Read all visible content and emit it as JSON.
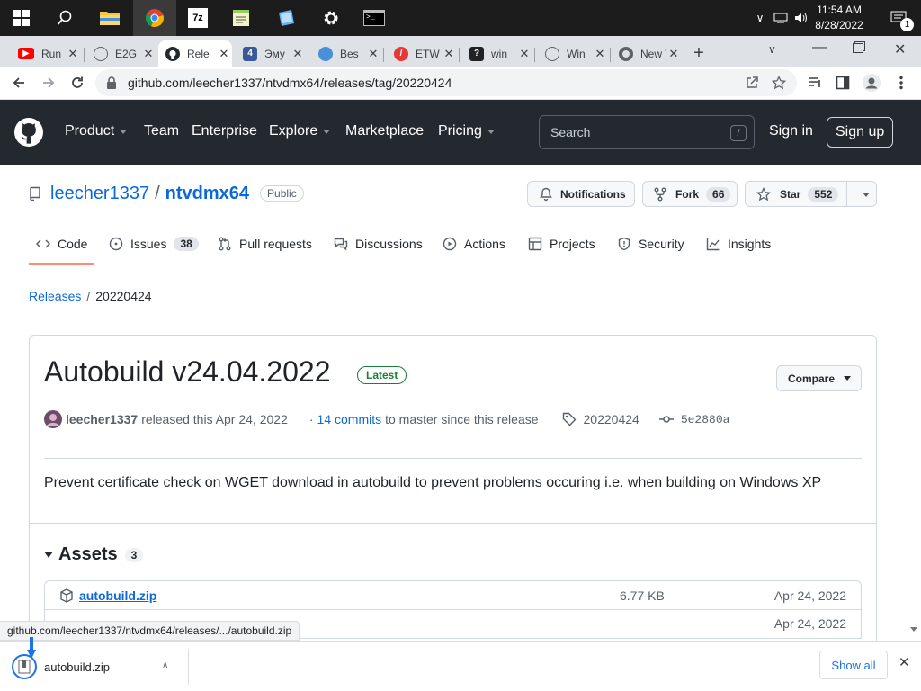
{
  "taskbar": {
    "time": "11:54 AM",
    "date": "8/28/2022",
    "notification_count": "1",
    "pinned": [
      {
        "name": "start-button",
        "color": "#ffffff"
      },
      {
        "name": "search-icon",
        "color": "#ffffff"
      },
      {
        "name": "file-explorer-icon",
        "color": "#f4c542"
      },
      {
        "name": "chrome-icon",
        "color": "#4285f4"
      },
      {
        "name": "7zip-icon",
        "color": "#ffffff"
      },
      {
        "name": "notepad-icon",
        "color": "#9ccc65"
      },
      {
        "name": "app-icon",
        "color": "#64b5f6"
      },
      {
        "name": "settings-icon",
        "color": "#ffffff"
      },
      {
        "name": "terminal-icon",
        "color": "#ffffff"
      }
    ]
  },
  "tabs": [
    {
      "label": "Run",
      "icon": "youtube-icon",
      "color": "#ff0000"
    },
    {
      "label": "E2G",
      "icon": "globe-icon",
      "color": "#5f6368"
    },
    {
      "label": "Rele",
      "icon": "github-icon",
      "color": "#24292f"
    },
    {
      "label": "Эму",
      "icon": "forum-icon",
      "color": "#3b5998"
    },
    {
      "label": "Bes",
      "icon": "puzzle-icon",
      "color": "#4a90d9"
    },
    {
      "label": "ETW",
      "icon": "opera-icon",
      "color": "#e53935"
    },
    {
      "label": "win",
      "icon": "question-icon",
      "color": "#202124"
    },
    {
      "label": "Win",
      "icon": "globe-icon",
      "color": "#5f6368"
    },
    {
      "label": "New Tab",
      "icon": "chrome-icon",
      "color": "#5f6368"
    }
  ],
  "address": {
    "url": "github.com/leecher1337/ntvdmx64/releases/tag/20220424"
  },
  "github": {
    "nav": {
      "product": "Product",
      "team": "Team",
      "enterprise": "Enterprise",
      "explore": "Explore",
      "marketplace": "Marketplace",
      "pricing": "Pricing"
    },
    "search_placeholder": "Search",
    "search_key": "/",
    "sign_in": "Sign in",
    "sign_up": "Sign up"
  },
  "repo": {
    "owner": "leecher1337",
    "separator": "/",
    "name": "ntvdmx64",
    "visibility": "Public",
    "notifications": "Notifications",
    "fork_label": "Fork",
    "fork_count": "66",
    "star_label": "Star",
    "star_count": "552"
  },
  "repo_tabs": {
    "code": "Code",
    "issues": "Issues",
    "issues_count": "38",
    "pulls": "Pull requests",
    "discussions": "Discussions",
    "actions": "Actions",
    "projects": "Projects",
    "security": "Security",
    "insights": "Insights"
  },
  "breadcrumb": {
    "releases": "Releases",
    "sep": "/",
    "tag": "20220424"
  },
  "release": {
    "title": "Autobuild v24.04.2022",
    "badge": "Latest",
    "compare": "Compare",
    "author": "leecher1337",
    "released_text": "released this Apr 24, 2022",
    "dot": "·",
    "commits_link": "14 commits",
    "commits_text": "to master since this release",
    "tag": "20220424",
    "commit": "5e2880a",
    "description": "Prevent certificate check on WGET download in autobuild to prevent problems occuring i.e. when building on Windows XP",
    "assets_title": "Assets",
    "assets_count": "3",
    "assets": [
      {
        "name": "autobuild.zip",
        "size": "6.77 KB",
        "date": "Apr 24, 2022"
      },
      {
        "name": "",
        "size": "",
        "date": "Apr 24, 2022"
      }
    ]
  },
  "statusbar": {
    "url": "github.com/leecher1337/ntvdmx64/releases/.../autobuild.zip"
  },
  "download": {
    "filename": "autobuild.zip",
    "show_all": "Show all"
  }
}
